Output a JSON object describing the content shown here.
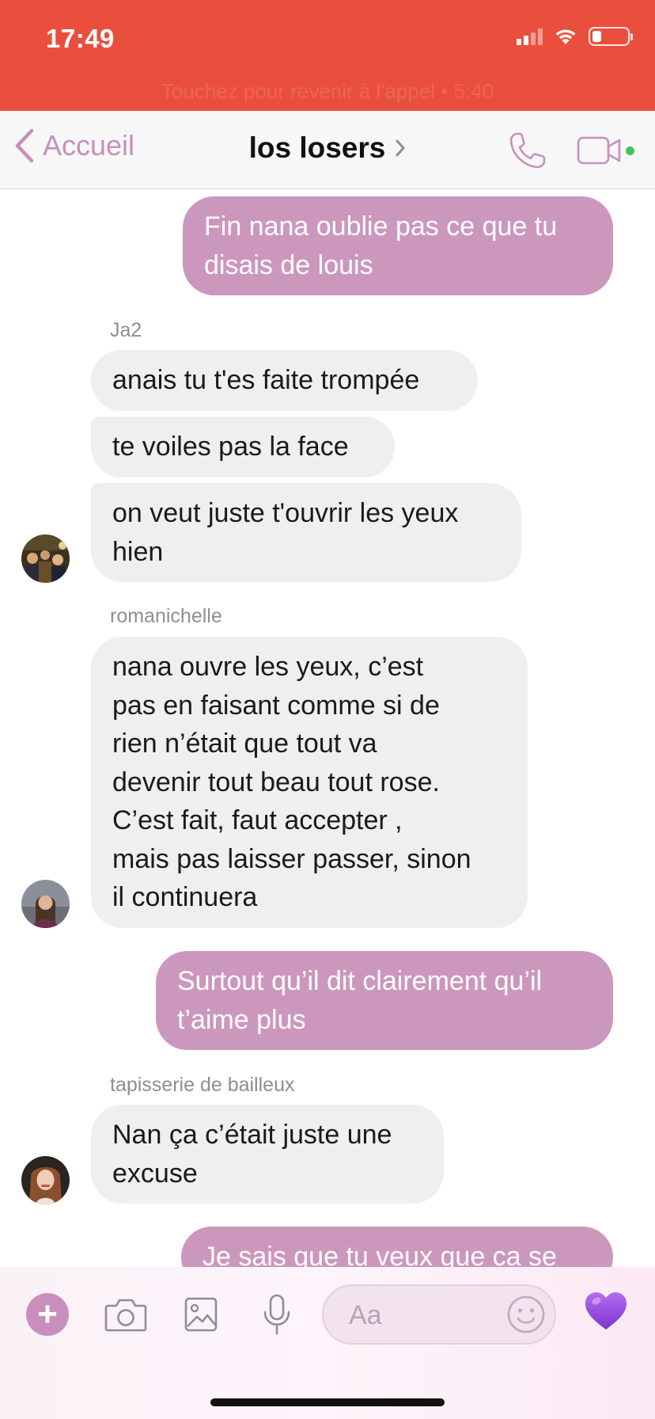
{
  "status_bar": {
    "time": "17:49",
    "banner": "Touchez pour revenir à l'appel • 5:40",
    "battery_level": 0.25,
    "colors": {
      "background": "#ea4f3d"
    }
  },
  "header": {
    "back_label": "Accueil",
    "title": "los losers",
    "icons": [
      "chevron-left-icon",
      "chevron-right-icon",
      "phone-icon",
      "video-camera-icon"
    ],
    "accent_color": "#c88fbd"
  },
  "messages": [
    {
      "type": "outgoing",
      "text": "Fin nana oublie pas ce que tu\ndisais de louis"
    },
    {
      "type": "sender",
      "name": "Ja2"
    },
    {
      "type": "incoming",
      "text": "anais tu t'es faite trompée"
    },
    {
      "type": "incoming",
      "text": "te voiles pas la face"
    },
    {
      "type": "incoming",
      "text": "on veut juste t'ouvrir les yeux\nhien"
    },
    {
      "type": "sender",
      "name": "romanichelle"
    },
    {
      "type": "incoming",
      "text": "nana ouvre les yeux, c’est\npas en faisant comme si de\nrien n’était que tout va\ndevenir tout beau tout rose.\nC’est fait, faut accepter ,\nmais pas laisser passer, sinon\nil continuera"
    },
    {
      "type": "outgoing",
      "text": "Surtout qu’il dit clairement qu’il\nt’aime plus"
    },
    {
      "type": "sender",
      "name": "tapisserie de bailleux"
    },
    {
      "type": "incoming",
      "text": "Nan ça c’était juste une\nexcuse"
    },
    {
      "type": "outgoing",
      "text": "Je sais que tu veux que ca se"
    }
  ],
  "composer": {
    "placeholder": "Aa",
    "icons": [
      "plus-icon",
      "camera-icon",
      "image-icon",
      "microphone-icon",
      "emoji-icon",
      "heart-icon"
    ],
    "heart_color": "#9a4de0"
  },
  "colors": {
    "outgoing_bubble": "#cc97bd",
    "incoming_bubble": "#efefef"
  }
}
